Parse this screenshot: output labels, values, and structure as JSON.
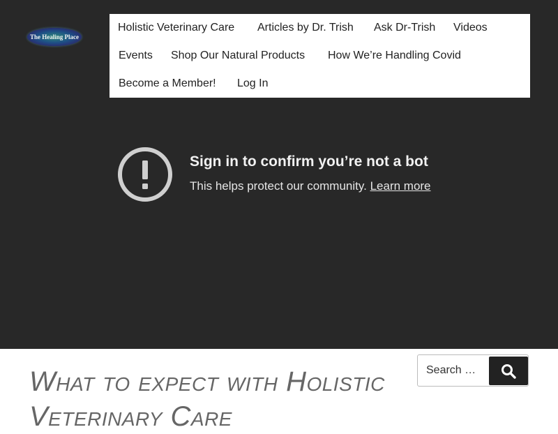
{
  "site": {
    "logo_text": "The Healing Place"
  },
  "nav": {
    "items": [
      "Holistic Veterinary Care",
      "Articles by Dr. Trish",
      "Ask Dr-Trish",
      "Videos",
      "Events",
      "Shop Our Natural Products",
      "How We’re Handling Covid",
      "Become a Member!",
      "Log In"
    ]
  },
  "video_notice": {
    "icon": "alert-circle-icon",
    "title": "Sign in to confirm you’re not a bot",
    "message": "This helps protect our community.",
    "link": "Learn more"
  },
  "page": {
    "title": "What to expect with Holistic Veterinary Care"
  },
  "search": {
    "placeholder": "Search …",
    "button_icon": "search-icon"
  },
  "colors": {
    "hero_background": "#282828",
    "nav_background": "#ffffff",
    "title_color": "#666666",
    "search_button": "#222222"
  }
}
